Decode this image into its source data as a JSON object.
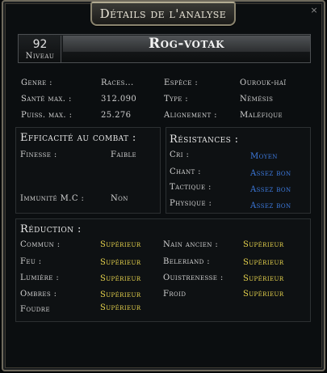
{
  "window": {
    "title": "Détails de l'analyse",
    "close_glyph": "×"
  },
  "character": {
    "level": "92",
    "level_label": "Niveau",
    "name": "Rog-votak"
  },
  "info": {
    "genre_label": "Genre :",
    "genre_value": "Races...",
    "espece_label": "Espèce :",
    "espece_value": "Ourouk-haï",
    "sante_label": "Santé max. :",
    "sante_value": "312.090",
    "type_label": "Type :",
    "type_value": "Némésis",
    "puiss_label": "Puiss. max. :",
    "puiss_value": "25.276",
    "align_label": "Alignement :",
    "align_value": "Maléfique"
  },
  "combat": {
    "title": "Efficacité au combat :",
    "finesse_label": "Finesse :",
    "finesse_value": "Faible",
    "immunite_label": "Immunité M.C :",
    "immunite_value": "Non"
  },
  "resistances": {
    "title": "Résistances :",
    "rows": [
      {
        "label": "Cri :",
        "value": "Moyen"
      },
      {
        "label": "Chant :",
        "value": "Assez bon"
      },
      {
        "label": "Tactique :",
        "value": "Assez bon"
      },
      {
        "label": "Physique :",
        "value": "Assez bon"
      }
    ]
  },
  "reduction": {
    "title": "Réduction :",
    "left": [
      {
        "label": "Commun :",
        "value": "Supérieur"
      },
      {
        "label": "Feu :",
        "value": "Supérieur"
      },
      {
        "label": "Lumière :",
        "value": "Supérieur"
      },
      {
        "label": "Ombres :",
        "value": "Supérieur"
      },
      {
        "label": "Foudre",
        "value": "Supérieur"
      }
    ],
    "right": [
      {
        "label": "Nain ancien :",
        "value": "Supérieur"
      },
      {
        "label": "Beleriand :",
        "value": "Supérieur"
      },
      {
        "label": "Ouistrenesse :",
        "value": "Supérieur"
      },
      {
        "label": "Froid",
        "value": "Supérieur"
      }
    ]
  },
  "colors": {
    "accent_value": "#e8d44d",
    "resistance_value": "#3d7be0",
    "frame": "#6f6a5d"
  }
}
